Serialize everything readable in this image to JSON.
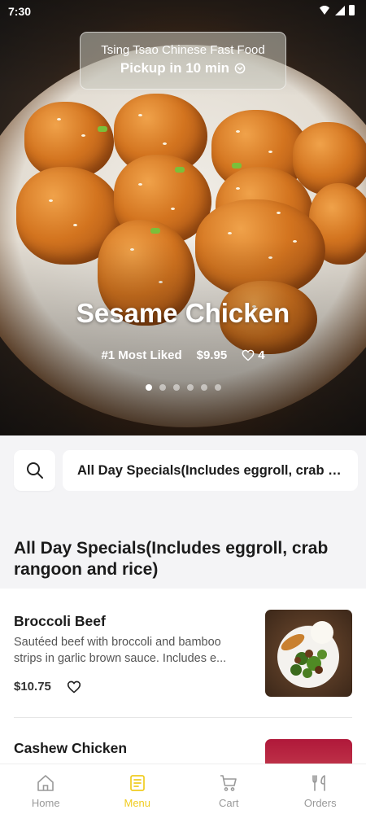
{
  "status_bar": {
    "time": "7:30"
  },
  "store": {
    "name": "Tsing Tsao Chinese Fast Food",
    "pickup": "Pickup in 10 min"
  },
  "featured": {
    "title": "Sesame Chicken",
    "rank": "#1 Most Liked",
    "price": "$9.95",
    "likes": "4",
    "carousel_pages": 6,
    "carousel_active_index": 0
  },
  "search": {
    "category_selected": "All Day Specials(Includes eggroll, crab rangoon and rice)"
  },
  "section": {
    "title": "All Day Specials(Includes eggroll, crab rangoon and rice)"
  },
  "menu_items": [
    {
      "name": "Broccoli Beef",
      "desc_line1": "Sautéed beef with broccoli and bamboo",
      "desc_line2": "strips in garlic brown sauce. Includes e...",
      "price": "$10.75"
    },
    {
      "name": "Cashew Chicken"
    }
  ],
  "nav": {
    "items": [
      {
        "label": "Home",
        "icon": "home-icon"
      },
      {
        "label": "Menu",
        "icon": "menu-icon"
      },
      {
        "label": "Cart",
        "icon": "cart-icon"
      },
      {
        "label": "Orders",
        "icon": "orders-icon"
      }
    ],
    "active": "Menu"
  },
  "colors": {
    "accent": "#f0cc20",
    "nav_inactive": "#999999",
    "background": "#f4f4f6"
  }
}
